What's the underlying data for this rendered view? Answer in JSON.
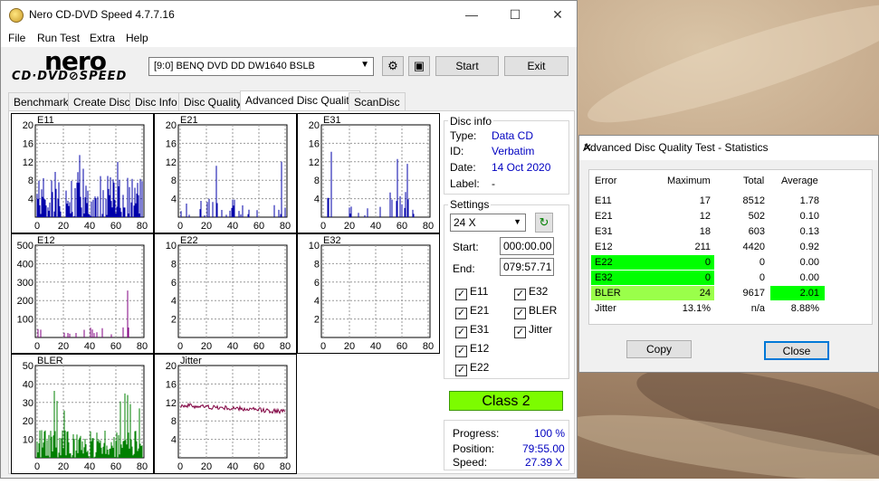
{
  "main_window": {
    "title": "Nero CD-DVD Speed 4.7.7.16",
    "controls": [
      "—",
      "☐",
      "✕"
    ],
    "menu": [
      "File",
      "Run Test",
      "Extra",
      "Help"
    ],
    "logo_nero": "nero",
    "logo_sub": "CD·DVD⊘SPEED",
    "drive": "[9:0]   BENQ DVD DD DW1640 BSLB",
    "start_label": "Start",
    "exit_label": "Exit",
    "tabs": [
      "Benchmark",
      "Create Disc",
      "Disc Info",
      "Disc Quality",
      "Advanced Disc Quality",
      "ScanDisc"
    ],
    "active_tab": "Advanced Disc Quality"
  },
  "disc_info": {
    "title": "Disc info",
    "type_label": "Type:",
    "type": "Data CD",
    "id_label": "ID:",
    "id": "Verbatim",
    "date_label": "Date:",
    "date": "14 Oct 2020",
    "label_label": "Label:",
    "label": "-"
  },
  "settings": {
    "title": "Settings",
    "speed": "24 X",
    "start_label": "Start:",
    "start": "000:00.00",
    "end_label": "End:",
    "end": "079:57.71",
    "checks": [
      {
        "label": "E11",
        "checked": true
      },
      {
        "label": "E32",
        "checked": true
      },
      {
        "label": "E21",
        "checked": true
      },
      {
        "label": "BLER",
        "checked": true
      },
      {
        "label": "E31",
        "checked": true
      },
      {
        "label": "Jitter",
        "checked": true
      },
      {
        "label": "E12",
        "checked": true
      },
      {
        "label": "E22",
        "checked": true
      }
    ]
  },
  "class_label": "Class 2",
  "progress": {
    "progress_label": "Progress:",
    "progress": "100 %",
    "position_label": "Position:",
    "position": "79:55.00",
    "speed_label": "Speed:",
    "speed": "27.39 X"
  },
  "charts": [
    {
      "name": "E11",
      "yticks": [
        "20",
        "16",
        "12",
        "8",
        "4"
      ],
      "xticks": [
        "0",
        "20",
        "40",
        "60",
        "80"
      ],
      "color": "#0000aa"
    },
    {
      "name": "E21",
      "yticks": [
        "20",
        "16",
        "12",
        "8",
        "4"
      ],
      "xticks": [
        "0",
        "20",
        "40",
        "60",
        "80"
      ],
      "color": "#0000aa"
    },
    {
      "name": "E31",
      "yticks": [
        "20",
        "16",
        "12",
        "8",
        "4"
      ],
      "xticks": [
        "0",
        "20",
        "40",
        "60",
        "80"
      ],
      "color": "#0000aa"
    },
    {
      "name": "E12",
      "yticks": [
        "500",
        "400",
        "300",
        "200",
        "100"
      ],
      "xticks": [
        "0",
        "20",
        "40",
        "60",
        "80"
      ],
      "color": "#800080"
    },
    {
      "name": "E22",
      "yticks": [
        "10",
        "8",
        "6",
        "4",
        "2"
      ],
      "xticks": [
        "0",
        "20",
        "40",
        "60",
        "80"
      ],
      "color": "#0000aa"
    },
    {
      "name": "E32",
      "yticks": [
        "10",
        "8",
        "6",
        "4",
        "2"
      ],
      "xticks": [
        "0",
        "20",
        "40",
        "60",
        "80"
      ],
      "color": "#0000aa"
    },
    {
      "name": "BLER",
      "yticks": [
        "50",
        "40",
        "30",
        "20",
        "10"
      ],
      "xticks": [
        "0",
        "20",
        "40",
        "60",
        "80"
      ],
      "color": "#008000"
    },
    {
      "name": "Jitter",
      "yticks": [
        "20",
        "16",
        "12",
        "8",
        "4"
      ],
      "xticks": [
        "0",
        "20",
        "40",
        "60",
        "80"
      ],
      "color": "#800040"
    }
  ],
  "stats_dialog": {
    "title": "Advanced Disc Quality Test - Statistics",
    "headers": [
      "Error",
      "Maximum",
      "Total",
      "Average"
    ],
    "rows": [
      {
        "error": "E11",
        "max": "17",
        "total": "8512",
        "avg": "1.78"
      },
      {
        "error": "E21",
        "max": "12",
        "total": "502",
        "avg": "0.10"
      },
      {
        "error": "E31",
        "max": "18",
        "total": "603",
        "avg": "0.13"
      },
      {
        "error": "E12",
        "max": "211",
        "total": "4420",
        "avg": "0.92"
      },
      {
        "error": "E22",
        "max": "0",
        "total": "0",
        "avg": "0.00"
      },
      {
        "error": "E32",
        "max": "0",
        "total": "0",
        "avg": "0.00"
      },
      {
        "error": "BLER",
        "max": "24",
        "total": "9617",
        "avg": "2.01"
      },
      {
        "error": "Jitter",
        "max": "13.1%",
        "total": "n/a",
        "avg": "8.88%"
      }
    ],
    "copy_label": "Copy",
    "close_label": "Close",
    "highlight_colors": {
      "green": "#00ff00",
      "lime": "#9aff4a"
    }
  }
}
